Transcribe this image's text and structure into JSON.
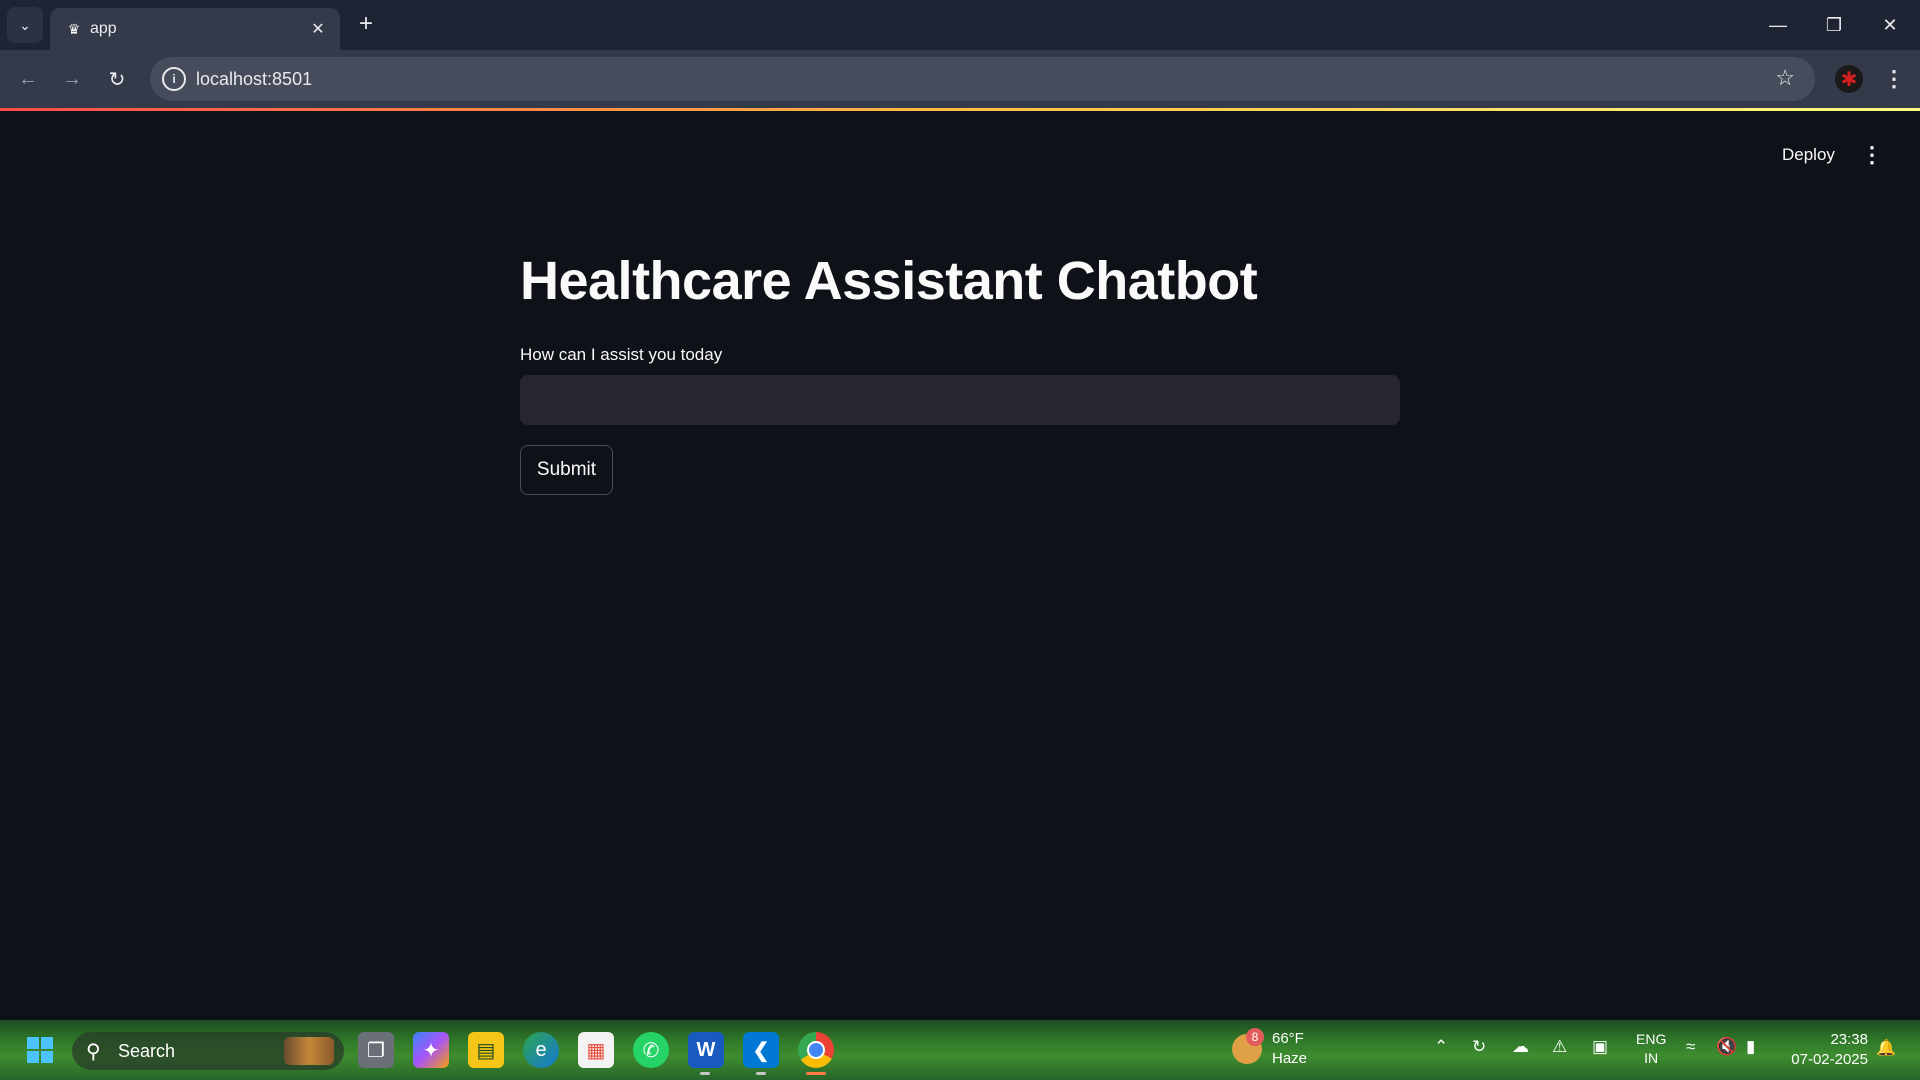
{
  "browser": {
    "tab_title": "app",
    "url": "localhost:8501"
  },
  "app": {
    "deploy_label": "Deploy",
    "title": "Healthcare Assistant Chatbot",
    "input_label": "How can I assist you today",
    "input_value": "",
    "submit_label": "Submit",
    "accent_colors": [
      "#ff4b4b",
      "#ffbd45",
      "#fffd80"
    ],
    "background": "#0e1117"
  },
  "taskbar": {
    "search_label": "Search",
    "weather_badge": "8",
    "temperature": "66°F",
    "condition": "Haze",
    "language_line1": "ENG",
    "language_line2": "IN",
    "time": "23:38",
    "date": "07-02-2025",
    "apps": [
      "start-icon",
      "task-view-icon",
      "copilot-icon",
      "file-explorer-icon",
      "edge-icon",
      "store-icon",
      "whatsapp-icon",
      "word-icon",
      "vscode-icon",
      "chrome-icon"
    ]
  }
}
